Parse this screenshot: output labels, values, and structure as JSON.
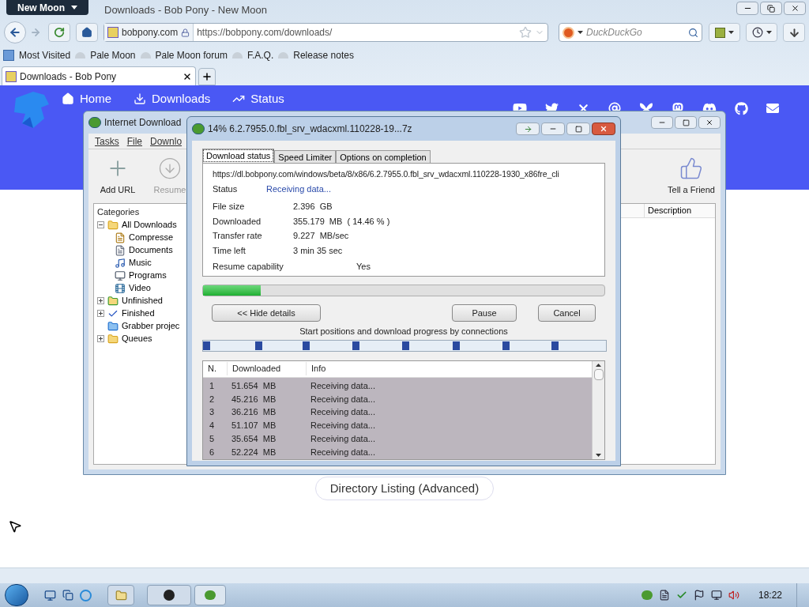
{
  "browser": {
    "app_button": "New Moon",
    "title": "Downloads - Bob Pony - New Moon",
    "identity": "bobpony.com",
    "url": "https://bobpony.com/downloads/",
    "search": {
      "placeholder": "DuckDuckGo"
    },
    "bookmarks": [
      "Most Visited",
      "Pale Moon",
      "Pale Moon forum",
      "F.A.Q.",
      "Release notes"
    ],
    "tabs": [
      {
        "label": "Downloads - Bob Pony",
        "selected": true
      }
    ]
  },
  "page": {
    "nav": [
      "Home",
      "Downloads",
      "Status"
    ],
    "listing_button": "Directory Listing (Advanced)"
  },
  "idm": {
    "title": "Internet Download",
    "menu": [
      "Tasks",
      "File",
      "Downlo"
    ],
    "toolbar": [
      {
        "label": "Add URL",
        "disabled": false
      },
      {
        "label": "Resume",
        "disabled": true
      },
      {
        "label": "Tell a Friend",
        "disabled": false
      }
    ],
    "categories_title": "Categories",
    "tree": [
      {
        "label": "All Downloads",
        "kind": "folder",
        "expanded": true,
        "children": [
          {
            "label": "Compresse",
            "kind": "zip"
          },
          {
            "label": "Documents",
            "kind": "document"
          },
          {
            "label": "Music",
            "kind": "music"
          },
          {
            "label": "Programs",
            "kind": "program"
          },
          {
            "label": "Video",
            "kind": "video"
          }
        ]
      },
      {
        "label": "Unfinished",
        "kind": "unfinished",
        "expanded": false
      },
      {
        "label": "Finished",
        "kind": "finished",
        "expanded": false
      },
      {
        "label": "Grabber projec",
        "kind": "grabber"
      },
      {
        "label": "Queues",
        "kind": "folder",
        "expanded": false
      }
    ],
    "columns": [
      "Description"
    ]
  },
  "dialog": {
    "title": "14% 6.2.7955.0.fbl_srv_wdacxml.110228-19...7z",
    "tabs": [
      {
        "label": "Download status",
        "selected": true
      },
      {
        "label": "Speed Limiter",
        "selected": false
      },
      {
        "label": "Options on completion",
        "selected": false
      }
    ],
    "url": "https://dl.bobpony.com/windows/beta/8/x86/6.2.7955.0.fbl_srv_wdacxml.110228-1930_x86fre_cli",
    "status_label": "Status",
    "status": "Receiving data...",
    "fields": [
      {
        "label": "File size",
        "value": "2.396  GB"
      },
      {
        "label": "Downloaded",
        "value": "355.179  MB  ( 14.46 % )"
      },
      {
        "label": "Transfer rate",
        "value": "9.227  MB/sec"
      },
      {
        "label": "Time left",
        "value": "3 min 35 sec"
      }
    ],
    "resume_label": "Resume capability",
    "resume_value": "Yes",
    "level": 0.1446,
    "buttons": [
      "<< Hide details",
      "Pause",
      "Cancel"
    ],
    "connections_label": "Start positions and download progress by connections",
    "table": {
      "columns": [
        "N.",
        "Downloaded",
        "Info"
      ],
      "rows": [
        [
          "1",
          "51.654  MB",
          "Receiving data..."
        ],
        [
          "2",
          "45.216  MB",
          "Receiving data..."
        ],
        [
          "3",
          "36.216  MB",
          "Receiving data..."
        ],
        [
          "4",
          "51.107  MB",
          "Receiving data..."
        ],
        [
          "5",
          "35.654  MB",
          "Receiving data..."
        ],
        [
          "6",
          "52.224  MB",
          "Receiving data..."
        ]
      ]
    }
  },
  "taskbar": {
    "clock": "18:22"
  }
}
